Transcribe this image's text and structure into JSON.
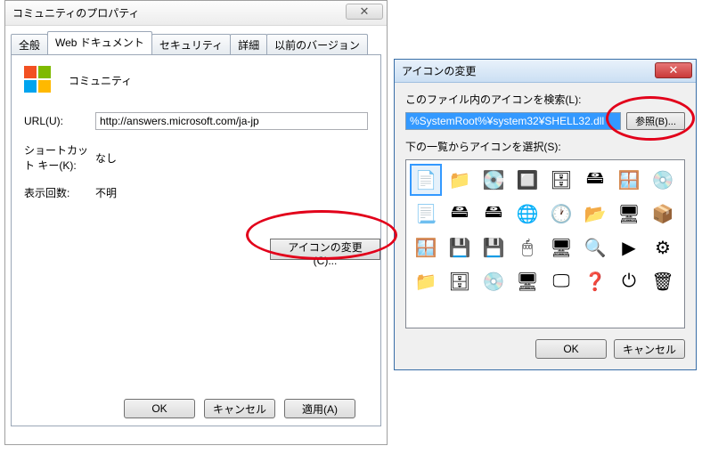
{
  "props": {
    "title": "コミュニティのプロパティ",
    "tabs": [
      "全般",
      "Web ドキュメント",
      "セキュリティ",
      "詳細",
      "以前のバージョン"
    ],
    "active_tab": 1,
    "header_label": "コミュニティ",
    "url_label": "URL(U):",
    "url_value": "http://answers.microsoft.com/ja-jp",
    "shortcut_label": "ショートカット キー(K):",
    "shortcut_value": "なし",
    "visit_label": "表示回数:",
    "visit_value": "不明",
    "change_icon_btn": "アイコンの変更(C)...",
    "ok": "OK",
    "cancel": "キャンセル",
    "apply": "適用(A)"
  },
  "icon_dialog": {
    "title": "アイコンの変更",
    "search_label": "このファイル内のアイコンを検索(L):",
    "path_value": "%SystemRoot%¥system32¥SHELL32.dll",
    "browse": "参照(B)...",
    "select_label": "下の一覧からアイコンを選択(S):",
    "ok": "OK",
    "cancel": "キャンセル",
    "icons": [
      {
        "name": "page-icon",
        "glyph": "📄",
        "sel": true
      },
      {
        "name": "folder-icon",
        "glyph": "📁"
      },
      {
        "name": "disk-icon",
        "glyph": "💽"
      },
      {
        "name": "chip-icon",
        "glyph": "🔲"
      },
      {
        "name": "drive-icon",
        "glyph": "🗄"
      },
      {
        "name": "drive2-icon",
        "glyph": "🖴"
      },
      {
        "name": "window-icon",
        "glyph": "🪟"
      },
      {
        "name": "cd-icon",
        "glyph": "💿"
      },
      {
        "name": "document-icon",
        "glyph": "📃"
      },
      {
        "name": "net-drive-icon",
        "glyph": "🖴"
      },
      {
        "name": "net-drive-x-icon",
        "glyph": "🖴"
      },
      {
        "name": "globe-icon",
        "glyph": "🌐"
      },
      {
        "name": "clock-icon",
        "glyph": "🕐"
      },
      {
        "name": "folder-open-icon",
        "glyph": "📂"
      },
      {
        "name": "monitor-icon",
        "glyph": "🖥"
      },
      {
        "name": "box-icon",
        "glyph": "📦"
      },
      {
        "name": "app-icon",
        "glyph": "🪟"
      },
      {
        "name": "floppy-icon",
        "glyph": "💾"
      },
      {
        "name": "floppy-x-icon",
        "glyph": "💾"
      },
      {
        "name": "mouse-icon",
        "glyph": "🖱"
      },
      {
        "name": "pc-icon",
        "glyph": "🖥"
      },
      {
        "name": "search-icon",
        "glyph": "🔍"
      },
      {
        "name": "run-icon",
        "glyph": "▶"
      },
      {
        "name": "gear-icon",
        "glyph": "⚙"
      },
      {
        "name": "folder2-icon",
        "glyph": "📁"
      },
      {
        "name": "hd-icon",
        "glyph": "🗄"
      },
      {
        "name": "cd2-icon",
        "glyph": "💿"
      },
      {
        "name": "monitor2-icon",
        "glyph": "🖥"
      },
      {
        "name": "screen-icon",
        "glyph": "🖵"
      },
      {
        "name": "help-icon",
        "glyph": "❓"
      },
      {
        "name": "power-icon",
        "glyph": "⏻"
      },
      {
        "name": "bin-icon",
        "glyph": "🗑"
      }
    ]
  }
}
